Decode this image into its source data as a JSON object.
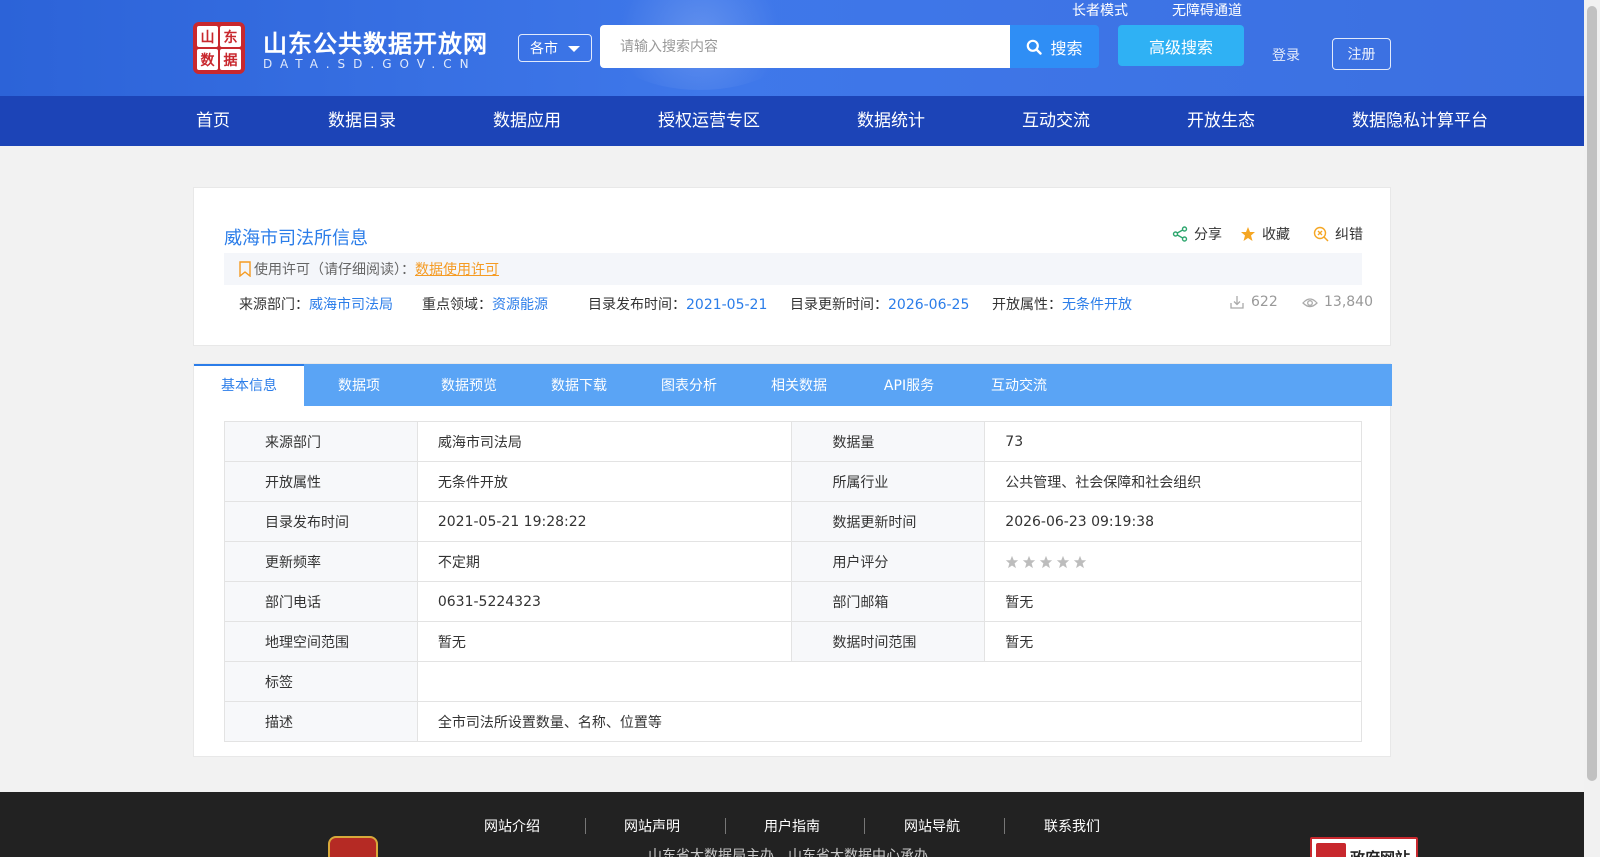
{
  "header": {
    "logo_chars": [
      "山",
      "东",
      "数",
      "据"
    ],
    "site_title": "山东公共数据开放网",
    "site_domain": "DATA.SD.GOV.CN",
    "city_select": "各市",
    "search_placeholder": "请输入搜索内容",
    "search_label": "搜索",
    "advanced_search_label": "高级搜索",
    "elder_mode": "长者模式",
    "accessibility": "无障碍通道",
    "login": "登录",
    "register": "注册"
  },
  "nav": [
    "首页",
    "数据目录",
    "数据应用",
    "授权运营专区",
    "数据统计",
    "互动交流",
    "开放生态",
    "数据隐私计算平台"
  ],
  "dataset": {
    "title": "威海市司法所信息",
    "actions": {
      "share": "分享",
      "favorite": "收藏",
      "report": "纠错"
    },
    "license_label": "使用许可（请仔细阅读）：",
    "license_link": "数据使用许可",
    "meta": {
      "source_label": "来源部门：",
      "source_value": "威海市司法局",
      "field_label": "重点领域：",
      "field_value": "资源能源",
      "publish_label": "目录发布时间：",
      "publish_value": "2021-05-21",
      "update_label": "目录更新时间：",
      "update_value": "2026-06-25",
      "open_label": "开放属性：",
      "open_value": "无条件开放"
    },
    "downloads": "622",
    "views": "13,840"
  },
  "tabs": [
    "基本信息",
    "数据项",
    "数据预览",
    "数据下载",
    "图表分析",
    "相关数据",
    "API服务",
    "互动交流"
  ],
  "basic_info": {
    "rows": [
      {
        "l1": "来源部门",
        "v1": "威海市司法局",
        "l2": "数据量",
        "v2": "73"
      },
      {
        "l1": "开放属性",
        "v1": "无条件开放",
        "l2": "所属行业",
        "v2": "公共管理、社会保障和社会组织"
      },
      {
        "l1": "目录发布时间",
        "v1": "2021-05-21 19:28:22",
        "l2": "数据更新时间",
        "v2": "2026-06-23 09:19:38"
      },
      {
        "l1": "更新频率",
        "v1": "不定期",
        "l2": "用户评分",
        "v2": ""
      },
      {
        "l1": "部门电话",
        "v1": "0631-5224323",
        "l2": "部门邮箱",
        "v2": "暂无"
      },
      {
        "l1": "地理空间范围",
        "v1": "暂无",
        "l2": "数据时间范围",
        "v2": "暂无"
      }
    ],
    "rating": 0,
    "rating_max": 5,
    "tags_label": "标签",
    "tags_value": "",
    "desc_label": "描述",
    "desc_value": "全市司法所设置数量、名称、位置等"
  },
  "footer": {
    "links": [
      "网站介绍",
      "网站声明",
      "用户指南",
      "网站导航",
      "联系我们"
    ],
    "text": "山东省大数据局主办　山东省大数据中心承办",
    "gov_badge": "政府网站"
  },
  "colors": {
    "accent": "#2b7de9",
    "nav_bg": "#1c44b7",
    "tab_bg": "#5aa4f5",
    "license": "#f59b23"
  }
}
